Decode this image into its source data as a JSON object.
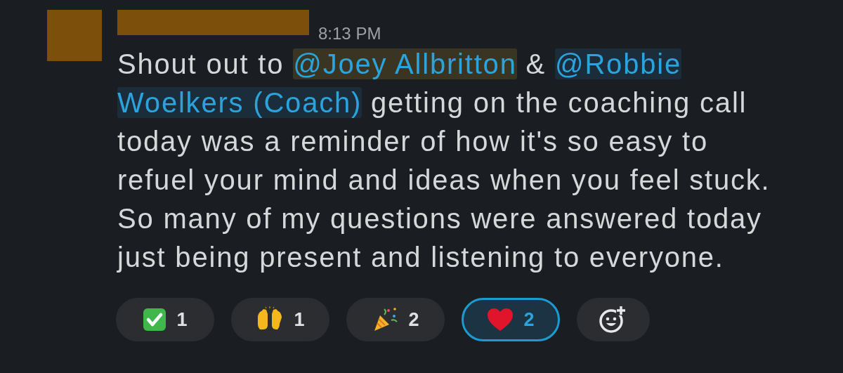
{
  "author": {
    "avatar_redacted": true,
    "name_redacted": true
  },
  "time": "8:13 PM",
  "message_lines": [
    [
      {
        "kind": "text",
        "text": "Shout out to "
      },
      {
        "kind": "mention",
        "text": "@Joey Allbritton",
        "highlighted": true
      },
      {
        "kind": "text",
        "text": " & "
      },
      {
        "kind": "mention",
        "text": "@Robbie",
        "highlighted": false
      }
    ],
    [
      {
        "kind": "mention",
        "text": "Woelkers (Coach)",
        "highlighted": false
      },
      {
        "kind": "text",
        "text": " getting on the coaching call"
      }
    ],
    [
      {
        "kind": "text",
        "text": "today was a reminder of how it's so easy to"
      }
    ],
    [
      {
        "kind": "text",
        "text": "refuel your mind and ideas when you feel stuck."
      }
    ],
    [
      {
        "kind": "text",
        "text": "So many of my questions were answered today"
      }
    ],
    [
      {
        "kind": "text",
        "text": "just being present and listening to everyone."
      }
    ]
  ],
  "reactions": [
    {
      "kind": "check",
      "count": "1",
      "selected": false
    },
    {
      "kind": "raised-hands",
      "count": "1",
      "selected": false
    },
    {
      "kind": "party-popper",
      "count": "2",
      "selected": false
    },
    {
      "kind": "heart",
      "count": "2",
      "selected": true
    }
  ]
}
